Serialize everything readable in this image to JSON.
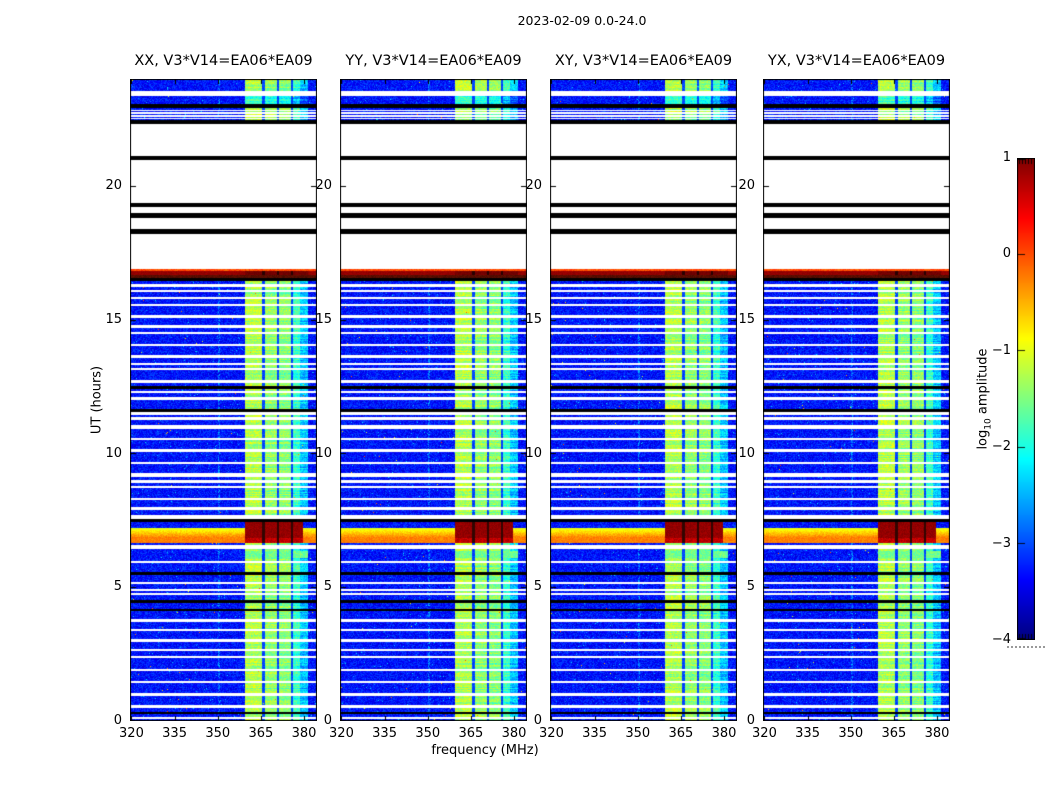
{
  "figure": {
    "title": "2023-02-09 0.0-24.0",
    "xlabel": "frequency (MHz)",
    "ylabel": "UT (hours)",
    "colorbar_label_prefix": "log",
    "colorbar_label_sub": "10",
    "colorbar_label_suffix": " amplitude"
  },
  "chart_data": {
    "type": "heatmap",
    "description": "Four dynamic spectra (UT hours vs frequency) of cross-power amplitude for polarization products XX, YY, XY, YX of baseline V3*V14=EA06*EA09, 2023-02-09 0.0-24.0 UT, with jet colormap of log10 amplitude from -4 to 1",
    "panels": [
      {
        "polarization": "XX",
        "title": "XX, V3*V14=EA06*EA09",
        "seed": 101
      },
      {
        "polarization": "YY",
        "title": "YY, V3*V14=EA06*EA09",
        "seed": 257
      },
      {
        "polarization": "XY",
        "title": "XY, V3*V14=EA06*EA09",
        "seed": 409
      },
      {
        "polarization": "YX",
        "title": "YX, V3*V14=EA06*EA09",
        "seed": 613
      }
    ],
    "x_axis": {
      "label": "frequency (MHz)",
      "range_mhz": [
        319.5,
        384.5
      ],
      "ticks": [
        320,
        335,
        350,
        365,
        380
      ],
      "tick_labels": [
        "320",
        "335",
        "350",
        "365",
        "380"
      ]
    },
    "y_axis": {
      "label": "UT (hours)",
      "range_hours": [
        0,
        24
      ],
      "ticks": [
        0,
        5,
        10,
        15,
        20
      ],
      "tick_labels": [
        "0",
        "5",
        "10",
        "15",
        "20"
      ]
    },
    "colorbar": {
      "label": "log10 amplitude",
      "range": [
        -4,
        1
      ],
      "ticks": [
        1,
        0,
        -1,
        -2,
        -3,
        -4
      ],
      "tick_labels": [
        "1",
        "0",
        "−1",
        "−2",
        "−3",
        "−4"
      ],
      "colormap": "jet"
    },
    "features": {
      "background_level_log10": [
        -3.6,
        -3.0
      ],
      "rfi_band": {
        "segments_mhz": [
          [
            359.5,
            366.0,
            -1.35
          ],
          [
            366.0,
            371.0,
            -1.5
          ],
          [
            371.0,
            375.8,
            -1.55
          ],
          [
            375.8,
            378.5,
            -1.95
          ],
          [
            378.5,
            381.5,
            -2.5
          ]
        ],
        "notch_gaps_mhz": [
          366.0,
          371.0,
          375.8
        ],
        "notch_level": -3.2
      },
      "faint_line_mhz": 350.5,
      "observation_gap": {
        "start_h": 16.9,
        "end_h": 22.3,
        "black_lines_h": [
          18.3,
          18.9,
          19.3,
          21.05
        ]
      },
      "saturated_band": {
        "start_h": 16.55,
        "end_h": 16.9,
        "level": 0.9
      },
      "burst_event": {
        "start_h": 6.65,
        "end_h": 7.45,
        "peak_level": 1.0,
        "wideband_level": -0.4
      },
      "bright_band_rows": {
        "start_h": 6.1,
        "end_h": 6.35,
        "level": -1.7
      },
      "top_blocks": [
        {
          "start_h": 23.55,
          "end_h": 24.0,
          "type": "data"
        },
        {
          "start_h": 23.38,
          "end_h": 23.55,
          "type": "gap"
        },
        {
          "start_h": 23.05,
          "end_h": 23.38,
          "type": "data-cyan"
        },
        {
          "start_h": 22.9,
          "end_h": 23.05,
          "type": "flagged"
        },
        {
          "start_h": 22.45,
          "end_h": 22.9,
          "type": "data-striped"
        },
        {
          "start_h": 22.3,
          "end_h": 22.45,
          "type": "flagged"
        }
      ],
      "striped_gaps_h": [
        22.52,
        22.62,
        22.72,
        22.82
      ],
      "white_gaps_h": [
        16.28,
        16.08,
        15.82,
        15.55,
        15.12,
        14.75,
        14.5,
        14.05,
        13.62,
        13.35,
        13.15,
        12.7,
        12.3,
        12.05,
        11.5,
        11.3,
        11.0,
        10.55,
        10.12,
        9.65,
        9.2,
        8.95,
        8.75,
        8.3,
        7.95,
        7.62,
        6.5,
        5.95,
        5.15,
        4.9,
        4.75,
        3.75,
        3.4,
        3.0,
        2.65,
        2.4,
        1.9,
        1.45,
        1.0,
        0.55,
        0.12
      ],
      "wide_gaps_h": [
        6.5,
        7.62,
        9.2,
        11.0
      ],
      "black_lines_h": [
        16.5,
        12.45,
        11.62,
        7.5,
        5.5,
        4.45,
        4.15,
        0.3
      ]
    }
  }
}
